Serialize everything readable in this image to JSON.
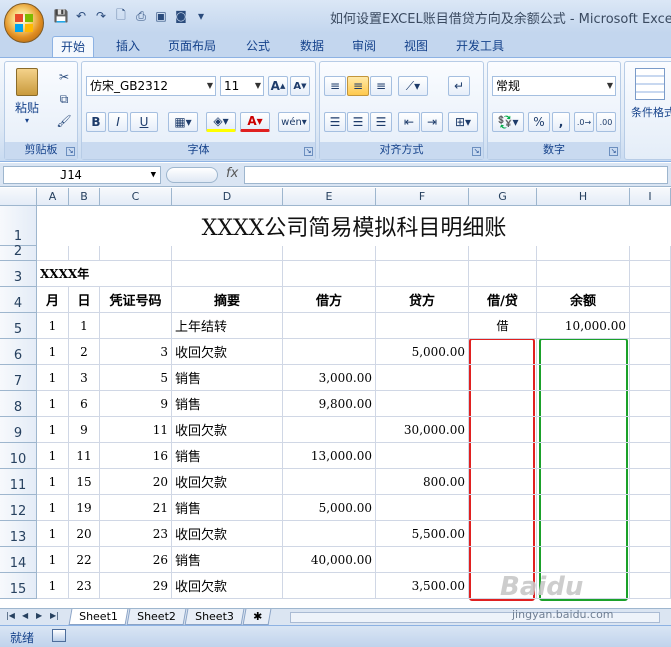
{
  "window": {
    "title": "如何设置EXCEL账目借贷方向及余额公式 - Microsoft Excel"
  },
  "tabs": [
    "开始",
    "插入",
    "页面布局",
    "公式",
    "数据",
    "审阅",
    "视图",
    "开发工具"
  ],
  "ribbon": {
    "clipboard": {
      "paste_label": "粘贴",
      "group_label": "剪贴板"
    },
    "font": {
      "name": "仿宋_GB2312",
      "size": "11",
      "group_label": "字体",
      "bold": "B",
      "italic": "I",
      "underline": "U"
    },
    "alignment": {
      "group_label": "对齐方式"
    },
    "number": {
      "format": "常规",
      "group_label": "数字",
      "percent": "%",
      "comma": ","
    },
    "styles": {
      "conditional_label": "条件格式"
    }
  },
  "formula_bar": {
    "cell_ref": "J14",
    "fx": "fx",
    "content": ""
  },
  "columns": [
    "A",
    "B",
    "C",
    "D",
    "E",
    "F",
    "G",
    "H",
    "I"
  ],
  "sheet": {
    "title": "XXXX公司简易模拟科目明细账",
    "year_label": "XXXX年",
    "headers": [
      "月",
      "日",
      "凭证号码",
      "摘要",
      "借方",
      "贷方",
      "借/贷",
      "余额"
    ],
    "rows": [
      {
        "row": "5",
        "m": "1",
        "d": "1",
        "no": "",
        "desc": "上年结转",
        "debit": "",
        "credit": "",
        "dir": "借",
        "bal": "10,000.00"
      },
      {
        "row": "6",
        "m": "1",
        "d": "2",
        "no": "3",
        "desc": "收回欠款",
        "debit": "",
        "credit": "5,000.00",
        "dir": "",
        "bal": ""
      },
      {
        "row": "7",
        "m": "1",
        "d": "3",
        "no": "5",
        "desc": "销售",
        "debit": "3,000.00",
        "credit": "",
        "dir": "",
        "bal": ""
      },
      {
        "row": "8",
        "m": "1",
        "d": "6",
        "no": "9",
        "desc": "销售",
        "debit": "9,800.00",
        "credit": "",
        "dir": "",
        "bal": ""
      },
      {
        "row": "9",
        "m": "1",
        "d": "9",
        "no": "11",
        "desc": "收回欠款",
        "debit": "",
        "credit": "30,000.00",
        "dir": "",
        "bal": ""
      },
      {
        "row": "10",
        "m": "1",
        "d": "11",
        "no": "16",
        "desc": "销售",
        "debit": "13,000.00",
        "credit": "",
        "dir": "",
        "bal": ""
      },
      {
        "row": "11",
        "m": "1",
        "d": "15",
        "no": "20",
        "desc": "收回欠款",
        "debit": "",
        "credit": "800.00",
        "dir": "",
        "bal": ""
      },
      {
        "row": "12",
        "m": "1",
        "d": "19",
        "no": "21",
        "desc": "销售",
        "debit": "5,000.00",
        "credit": "",
        "dir": "",
        "bal": ""
      },
      {
        "row": "13",
        "m": "1",
        "d": "20",
        "no": "23",
        "desc": "收回欠款",
        "debit": "",
        "credit": "5,500.00",
        "dir": "",
        "bal": ""
      },
      {
        "row": "14",
        "m": "1",
        "d": "22",
        "no": "26",
        "desc": "销售",
        "debit": "40,000.00",
        "credit": "",
        "dir": "",
        "bal": ""
      },
      {
        "row": "15",
        "m": "1",
        "d": "23",
        "no": "29",
        "desc": "收回欠款",
        "debit": "",
        "credit": "3,500.00",
        "dir": "",
        "bal": ""
      }
    ]
  },
  "sheet_tabs": [
    "Sheet1",
    "Sheet2",
    "Sheet3"
  ],
  "status": {
    "ready": "就绪"
  },
  "watermark": {
    "logo": "Baidu",
    "url": "jingyan.baidu.com"
  },
  "colors": {
    "highlight_red": "#e02020",
    "highlight_green": "#1aa12a",
    "ribbon_blue": "#c3d6ee"
  }
}
